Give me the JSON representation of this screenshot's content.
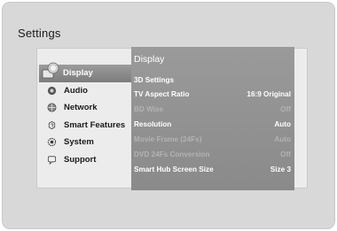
{
  "title": "Settings",
  "nav": {
    "items": [
      {
        "label": "Display",
        "icon": "display-icon",
        "active": true
      },
      {
        "label": "Audio",
        "icon": "audio-icon",
        "active": false
      },
      {
        "label": "Network",
        "icon": "network-icon",
        "active": false
      },
      {
        "label": "Smart Features",
        "icon": "smart-features-icon",
        "active": false
      },
      {
        "label": "System",
        "icon": "system-icon",
        "active": false
      },
      {
        "label": "Support",
        "icon": "support-icon",
        "active": false
      }
    ]
  },
  "panel": {
    "title": "Display",
    "options": [
      {
        "label": "3D Settings",
        "value": "",
        "enabled": true
      },
      {
        "label": "TV Aspect Ratio",
        "value": "16:9 Original",
        "enabled": true
      },
      {
        "label": "BD Wise",
        "value": "Off",
        "enabled": false
      },
      {
        "label": "Resolution",
        "value": "Auto",
        "enabled": true
      },
      {
        "label": "Movie Frame (24Fs)",
        "value": "Auto",
        "enabled": false
      },
      {
        "label": "DVD 24Fs Conversion",
        "value": "Off",
        "enabled": false
      },
      {
        "label": "Smart Hub Screen Size",
        "value": "Size 3",
        "enabled": true
      }
    ]
  },
  "colors": {
    "background": "#d8d8d8",
    "panel": "#909090",
    "selection": "#8a8a8a",
    "disabled_text": "#b3b3b3"
  }
}
